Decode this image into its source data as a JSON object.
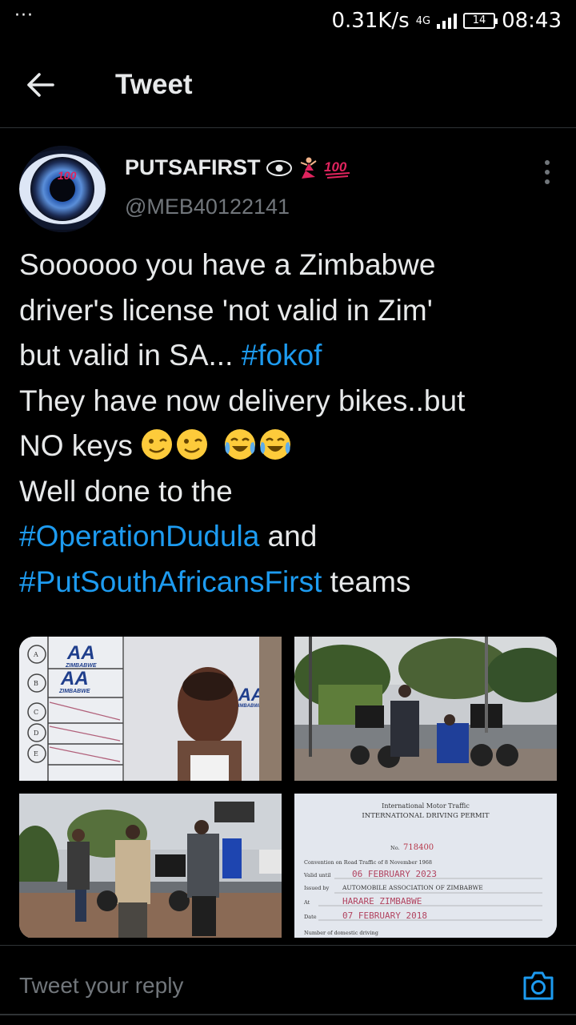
{
  "status_bar": {
    "dots": "···",
    "net_speed": "0.31K/s",
    "network": "4G",
    "battery": "14",
    "time": "08:43"
  },
  "header": {
    "back_icon": "arrow-left-icon",
    "title": "Tweet"
  },
  "tweet": {
    "author_name": "PUTSAFIRST",
    "author_emoji": "👁‍🗨💃💯",
    "handle": "@MEB40122141",
    "lines": [
      {
        "text": "Soooooo you have a Zimbabwe"
      },
      {
        "text": "driver's license 'not valid in Zim'"
      },
      {
        "text": "but valid in SA... ",
        "tag": "#fokof"
      },
      {
        "text": "They have now delivery bikes..but"
      },
      {
        "text": "NO keys "
      },
      {
        "text": "Well done to the"
      },
      {
        "tag": "#OperationDudula",
        "after": " and"
      },
      {
        "tag": "#PutSouthAfricansFirst",
        "after": " teams"
      }
    ],
    "emojis": [
      "winking-face",
      "winking-face",
      "tears-of-joy-face",
      "tears-of-joy-face"
    ]
  },
  "media": {
    "image1": {
      "logo1": "AA",
      "sub1": "ZIMBABWE",
      "logo2": "AA",
      "sub2": "ZIMBABWE",
      "logo3": "AA",
      "sub3": "ZIMBABWE",
      "logo4": "AA",
      "rows": [
        "A",
        "B",
        "C",
        "D",
        "E"
      ]
    },
    "image4": {
      "line1": "International Motor Traffic",
      "line2": "INTERNATIONAL DRIVING PERMIT",
      "no_label": "No.",
      "number": "718400",
      "convention": "Convention on Road Traffic of 8 November 1968",
      "valid_label": "Valid until",
      "valid_value": "06  FEBRUARY  2023",
      "issued_label": "Issued by",
      "issued_value": "AUTOMOBILE ASSOCIATION OF ZIMBABWE",
      "at_label": "At",
      "at_value": "HARARE  ZIMBABWE",
      "date_label": "Date",
      "date_value": "07  FEBRUARY  2018",
      "number_label": "Number of domestic driving"
    }
  },
  "reply": {
    "placeholder": "Tweet your reply",
    "icon": "camera-icon"
  }
}
